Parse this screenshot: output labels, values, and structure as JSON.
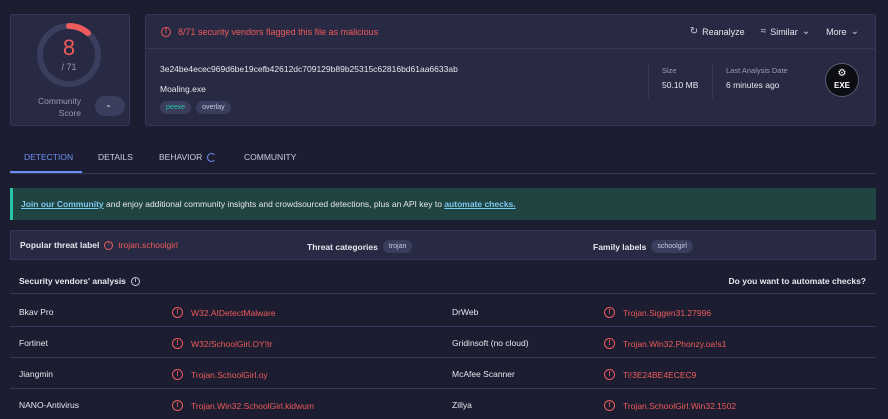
{
  "score": {
    "detected": "8",
    "total": "/ 71",
    "detected_count": 8,
    "total_count": 71,
    "community_label": "Community Score"
  },
  "header": {
    "alert": "8/71 security vendors flagged this file as malicious",
    "reanalyze": "Reanalyze",
    "similar": "Similar",
    "more": "More",
    "hash": "3e24be4ecec969d6be19cefb42612dc709129b89b25315c62816bd61aa6633ab",
    "filename": "Moaling.exe",
    "tags": [
      "peexe",
      "overlay"
    ],
    "size_label": "Size",
    "size_value": "50.10 MB",
    "last_label": "Last Analysis Date",
    "last_value": "6 minutes ago",
    "file_type": "EXE"
  },
  "tabs": [
    "DETECTION",
    "DETAILS",
    "BEHAVIOR",
    "COMMUNITY"
  ],
  "banner": {
    "link1": "Join our Community",
    "text": " and enjoy additional community insights and crowdsourced detections, plus an API key to ",
    "link2": "automate checks."
  },
  "threat": {
    "popular_label": "Popular threat label",
    "popular_value": "trojan.schoolgirl",
    "categories_label": "Threat categories",
    "categories_value": "trojan",
    "family_label": "Family labels",
    "family_value": "schoolgirl"
  },
  "analysis": {
    "title": "Security vendors' analysis",
    "automate": "Do you want to automate checks?"
  },
  "vendors": [
    {
      "left_name": "Bkav Pro",
      "left_result": "W32.AIDetectMalware",
      "right_name": "DrWeb",
      "right_result": "Trojan.Siggen31.27996"
    },
    {
      "left_name": "Fortinet",
      "left_result": "W32/SchoolGirl.OY!tr",
      "right_name": "Gridinsoft (no cloud)",
      "right_result": "Trojan.Win32.Phonzy.oa!s1"
    },
    {
      "left_name": "Jiangmin",
      "left_result": "Trojan.SchoolGirl.oy",
      "right_name": "McAfee Scanner",
      "right_result": "Ti!3E24BE4ECEC9"
    },
    {
      "left_name": "NANO-Antivirus",
      "left_result": "Trojan.Win32.SchoolGirl.kidwum",
      "right_name": "Zillya",
      "right_result": "Trojan.SchoolGirl.Win32.1502"
    }
  ],
  "colors": {
    "accent": "#6c8ff4",
    "danger": "#ee5b5b",
    "teal": "#27c4a8"
  }
}
